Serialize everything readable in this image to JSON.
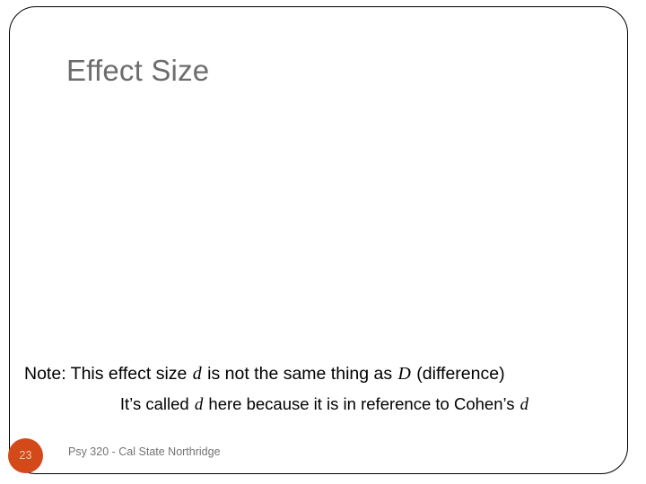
{
  "slide": {
    "title": "Effect Size",
    "title_color": "#6d6d6d",
    "background_color": "#ffffff",
    "border_color": "#000000"
  },
  "body": {
    "note_line": {
      "part1": "Note: This effect size ",
      "var1": "d",
      "part2": " is not the same thing as ",
      "var2": "D",
      "part3": " (difference)"
    },
    "cohen_line": {
      "part1": "It’s called ",
      "var1": "d",
      "part2": " here because it is in reference to Cohen’s ",
      "var2": "d",
      "part3": ""
    }
  },
  "footer": {
    "page_number": "23",
    "badge_color": "#d4491a",
    "course_text": "Psy 320 - Cal State Northridge",
    "course_text_color": "#737373"
  }
}
